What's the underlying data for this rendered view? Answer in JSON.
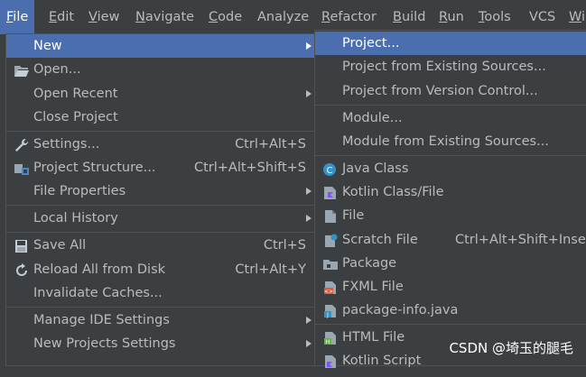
{
  "menubar": [
    {
      "label": "File",
      "u": "F",
      "rest": "ile"
    },
    {
      "label": "Edit",
      "u": "E",
      "rest": "dit"
    },
    {
      "label": "View",
      "u": "V",
      "rest": "iew"
    },
    {
      "label": "Navigate",
      "u": "N",
      "rest": "avigate"
    },
    {
      "label": "Code",
      "u": "C",
      "rest": "ode"
    },
    {
      "label": "Analyze",
      "u": "",
      "rest": "Analyze"
    },
    {
      "label": "Refactor",
      "u": "R",
      "rest": "efactor"
    },
    {
      "label": "Build",
      "u": "B",
      "rest": "uild"
    },
    {
      "label": "Run",
      "u": "R",
      "rest": "un"
    },
    {
      "label": "Tools",
      "u": "T",
      "rest": "ools"
    },
    {
      "label": "VCS",
      "u": "",
      "rest": "VCS"
    },
    {
      "label": "Wi",
      "u": "W",
      "rest": "i"
    }
  ],
  "file_menu": {
    "new": "New",
    "open": "Open...",
    "open_recent": "Open Recent",
    "close_project": "Close Project",
    "settings": "Settings...",
    "settings_sc": "Ctrl+Alt+S",
    "project_structure": "Project Structure...",
    "project_structure_sc": "Ctrl+Alt+Shift+S",
    "file_properties": "File Properties",
    "local_history": "Local History",
    "save_all": "Save All",
    "save_all_sc": "Ctrl+S",
    "reload": "Reload All from Disk",
    "reload_sc": "Ctrl+Alt+Y",
    "invalidate": "Invalidate Caches...",
    "manage_ide": "Manage IDE Settings",
    "new_projects_settings": "New Projects Settings"
  },
  "new_submenu": {
    "project": "Project...",
    "from_existing": "Project from Existing Sources...",
    "from_vcs": "Project from Version Control...",
    "module": "Module...",
    "module_existing": "Module from Existing Sources...",
    "java_class": "Java Class",
    "kotlin_class": "Kotlin Class/File",
    "file": "File",
    "scratch": "Scratch File",
    "scratch_sc": "Ctrl+Alt+Shift+Insert",
    "package": "Package",
    "fxml": "FXML File",
    "package_info": "package-info.java",
    "html": "HTML File",
    "kotlin_script": "Kotlin Script"
  },
  "watermark": "CSDN @埼玉的腿毛",
  "colors": {
    "background": "#3c3f41",
    "selection": "#4b6eaf",
    "text": "#bbbbbb"
  }
}
